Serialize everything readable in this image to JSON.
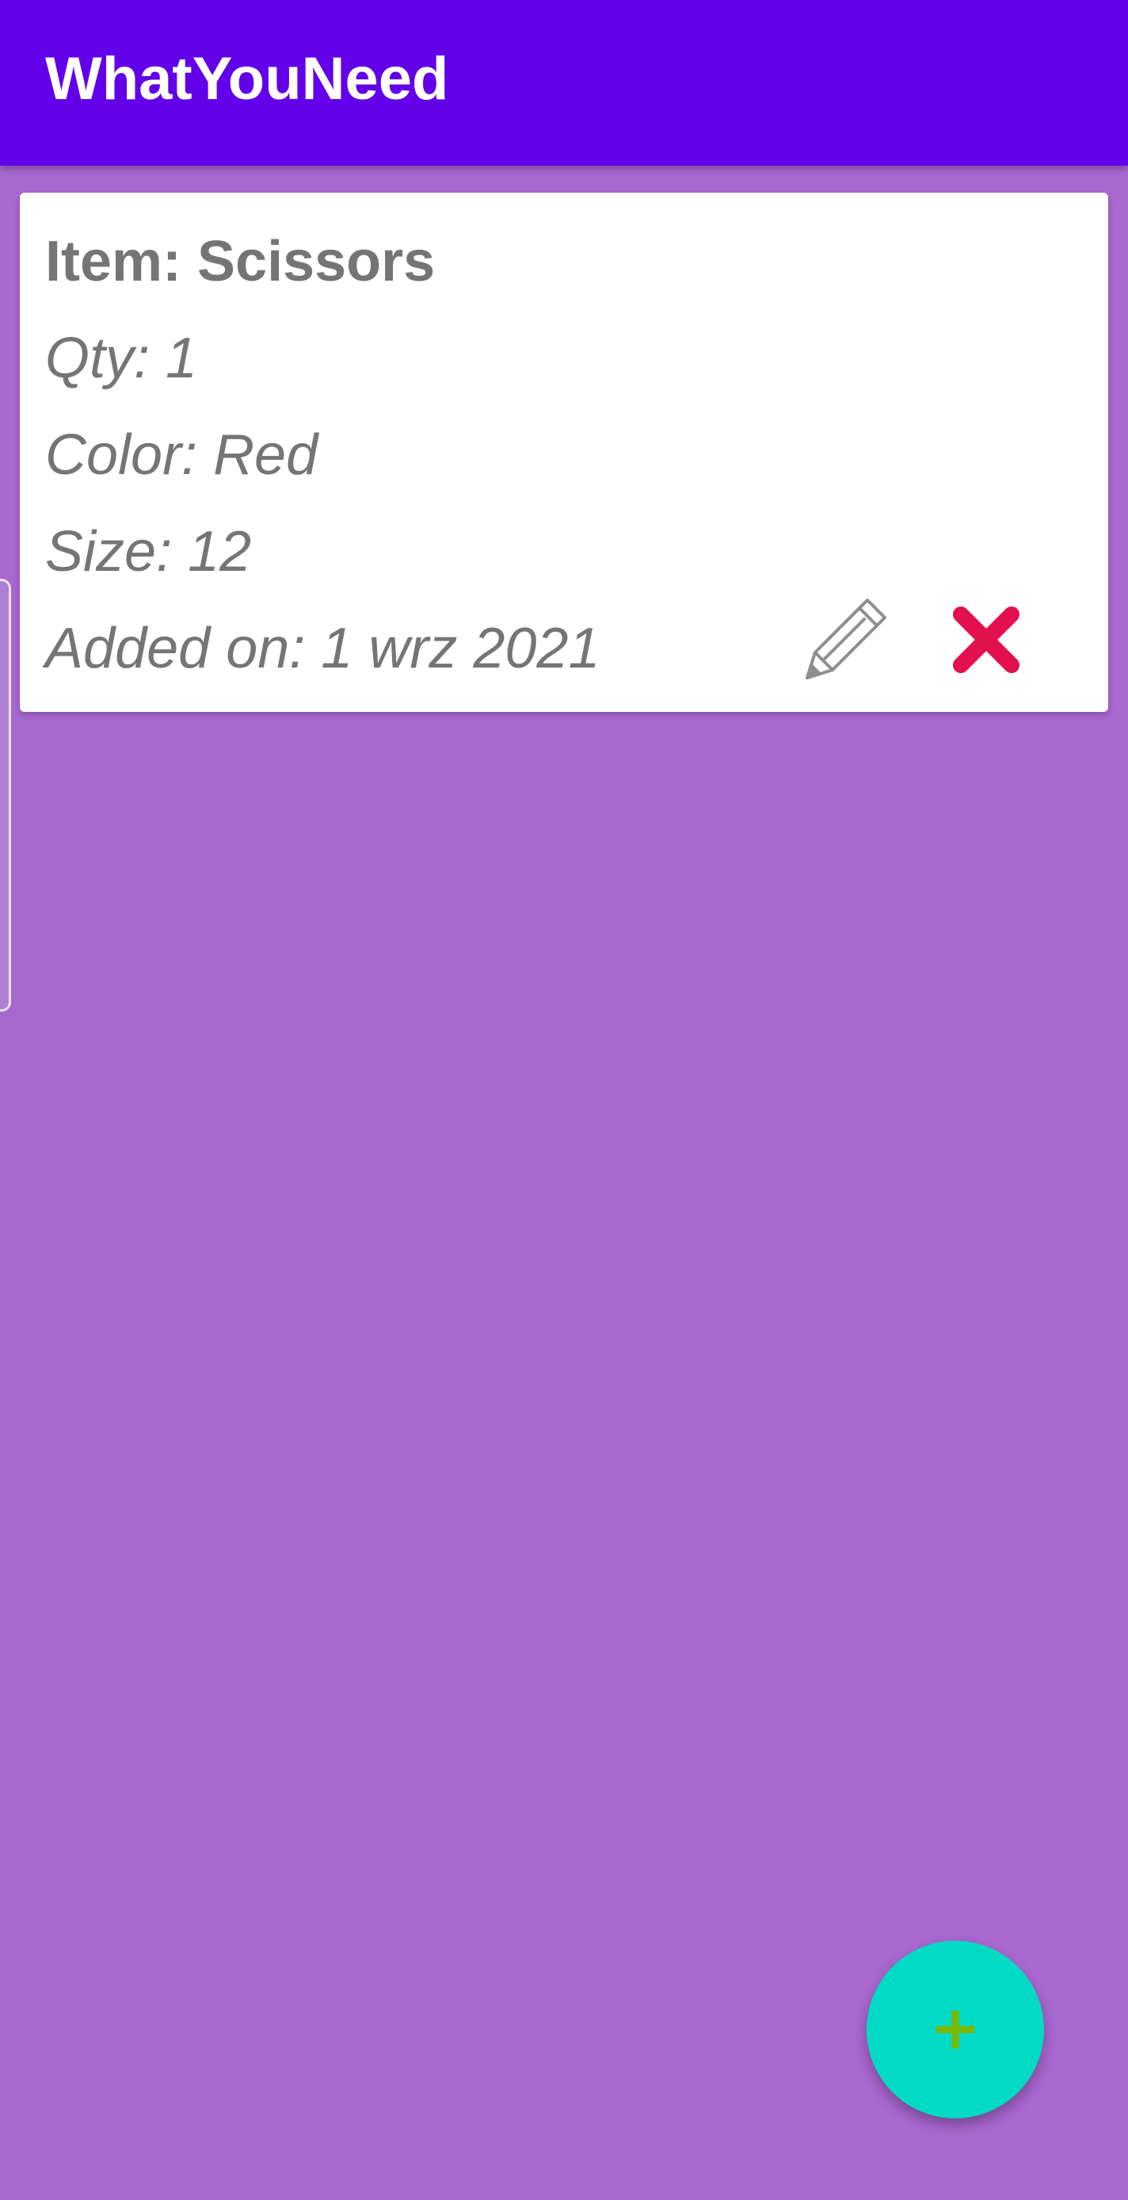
{
  "app_bar": {
    "title": "WhatYouNeed",
    "color": "#6200EA"
  },
  "background_color": "#A967D0",
  "items": [
    {
      "title": "Item: Scissors",
      "qty": "Qty: 1",
      "color": "Color: Red",
      "size": "Size:  12",
      "added_on": "Added on: 1 wrz 2021",
      "edit_icon": "pencil-icon",
      "delete_icon": "close-icon",
      "delete_icon_color": "#E3104E"
    }
  ],
  "fab": {
    "icon": "plus-icon",
    "color": "#03DAC5",
    "icon_color": "#7CB800"
  }
}
